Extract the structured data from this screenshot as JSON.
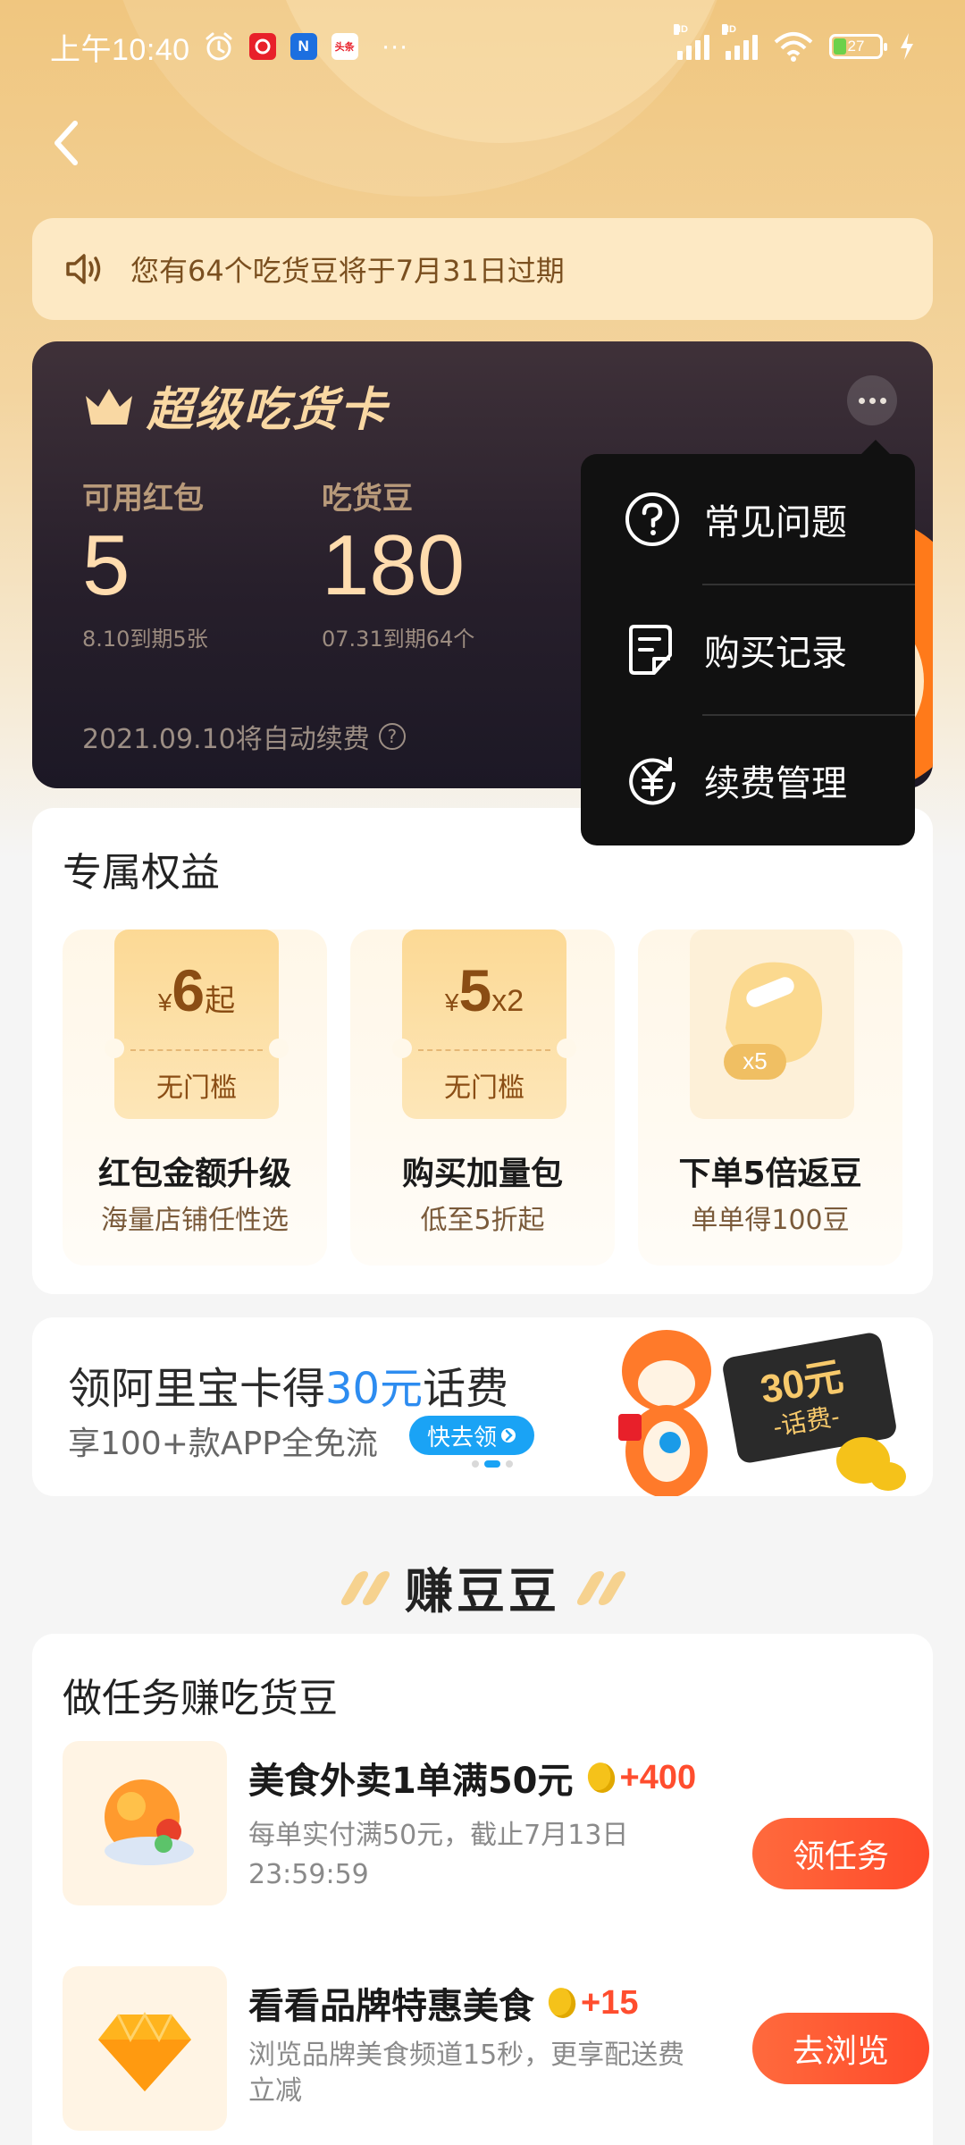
{
  "status_bar": {
    "time": "上午10:40",
    "apps": [
      "网易",
      "N",
      "头条"
    ],
    "more": "···",
    "battery": "27"
  },
  "notice": {
    "text": "您有64个吃货豆将于7月31日过期"
  },
  "card": {
    "title": "超级吃货卡",
    "stats": [
      {
        "label": "可用红包",
        "value": "5",
        "sub": "8.10到期5张"
      },
      {
        "label": "吃货豆",
        "value": "180",
        "sub": "07.31到期64个"
      }
    ],
    "renew_text": "2021.09.10将自动续费",
    "renew_help": "?"
  },
  "menu": {
    "items": [
      {
        "label": "常见问题",
        "icon": "question-icon"
      },
      {
        "label": "购买记录",
        "icon": "receipt-icon"
      },
      {
        "label": "续费管理",
        "icon": "yuan-refresh-icon"
      }
    ]
  },
  "benefits": {
    "title": "专属权益",
    "items": [
      {
        "currency": "¥",
        "amount": "6",
        "suffix": "起",
        "threshold": "无门槛",
        "name": "红包金额升级",
        "desc": "海量店铺任性选"
      },
      {
        "currency": "¥",
        "amount": "5",
        "suffix": "x2",
        "threshold": "无门槛",
        "name": "购买加量包",
        "desc": "低至5折起"
      },
      {
        "badge": "x5",
        "name": "下单5倍返豆",
        "desc": "单单得100豆"
      }
    ]
  },
  "banner": {
    "headline_pre": "领阿里宝卡得",
    "headline_highlight": "30元",
    "headline_post": "话费",
    "sub": "享100+款APP全免流",
    "cta": "快去领",
    "art_amount": "30元",
    "art_label": "-话费-"
  },
  "earn": {
    "title": "赚豆豆"
  },
  "tasks": {
    "title": "做任务赚吃货豆",
    "items": [
      {
        "name": "美食外卖1单满50元",
        "points": "+400",
        "desc": "每单实付满50元，截止7月13日 23:59:59",
        "button": "领任务"
      },
      {
        "name": "看看品牌特惠美食",
        "points": "+15",
        "desc": "浏览品牌美食频道15秒，更享配送费立减",
        "button": "去浏览"
      }
    ]
  },
  "colors": {
    "accent_orange": "#ff5a34",
    "gold": "#f9d8a3",
    "link_blue": "#2d8cf0"
  }
}
